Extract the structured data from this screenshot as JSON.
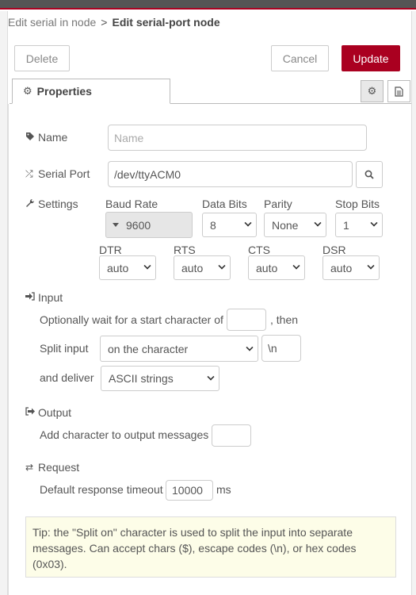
{
  "breadcrumb": {
    "parent": "Edit serial in node",
    "separator": ">",
    "current": "Edit serial-port node"
  },
  "buttons": {
    "delete": "Delete",
    "cancel": "Cancel",
    "update": "Update"
  },
  "tabs": {
    "properties": "Properties"
  },
  "fields": {
    "name": {
      "label": "Name",
      "placeholder": "Name",
      "value": ""
    },
    "serial_port": {
      "label": "Serial Port",
      "value": "/dev/ttyACM0"
    },
    "settings": {
      "label": "Settings"
    }
  },
  "settings": {
    "baud_rate": {
      "label": "Baud Rate",
      "value": "9600"
    },
    "data_bits": {
      "label": "Data Bits",
      "value": "8"
    },
    "parity": {
      "label": "Parity",
      "value": "None"
    },
    "stop_bits": {
      "label": "Stop Bits",
      "value": "1"
    },
    "dtr": {
      "label": "DTR",
      "value": "auto"
    },
    "rts": {
      "label": "RTS",
      "value": "auto"
    },
    "cts": {
      "label": "CTS",
      "value": "auto"
    },
    "dsr": {
      "label": "DSR",
      "value": "auto"
    }
  },
  "input": {
    "heading": "Input",
    "start_char_prefix": "Optionally wait for a start character of",
    "start_char_value": "",
    "start_char_suffix": ", then",
    "split_label": "Split input",
    "split_mode": "on the character",
    "split_value": "\\n",
    "deliver_label": "and deliver",
    "deliver_value": "ASCII strings"
  },
  "output": {
    "heading": "Output",
    "add_char_label": "Add character to output messages",
    "add_char_value": ""
  },
  "request": {
    "heading": "Request",
    "timeout_label": "Default response timeout",
    "timeout_value": "10000",
    "timeout_unit": "ms"
  },
  "tip": "Tip: the \"Split on\" character is used to split the input into separate messages. Can accept chars ($), escape codes (\\n), or hex codes (0x03).",
  "colors": {
    "primary": "#aa0020",
    "tip_bg": "#fdfde8"
  }
}
